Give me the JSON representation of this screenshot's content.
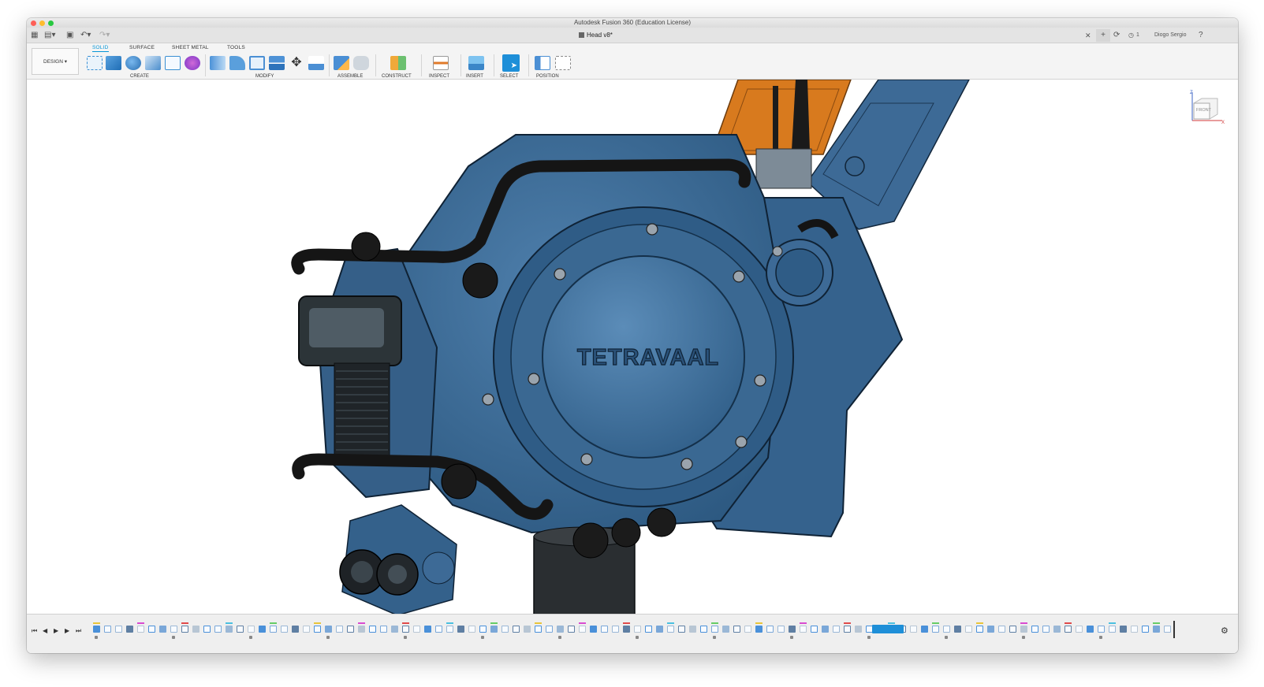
{
  "window": {
    "title": "Autodesk Fusion 360 (Education License)"
  },
  "tabbar": {
    "document_tab": "Head v8*",
    "user_name": "Diogo Sergio",
    "notification_count": "1"
  },
  "ribbon": {
    "workspace": "DESIGN",
    "tabs": [
      {
        "label": "SOLID",
        "active": true
      },
      {
        "label": "SURFACE",
        "active": false
      },
      {
        "label": "SHEET METAL",
        "active": false
      },
      {
        "label": "TOOLS",
        "active": false
      }
    ],
    "groups": {
      "create": "CREATE",
      "modify": "MODIFY",
      "assemble": "ASSEMBLE",
      "construct": "CONSTRUCT",
      "inspect": "INSPECT",
      "insert": "INSERT",
      "select": "SELECT",
      "position": "POSITION"
    }
  },
  "viewport": {
    "model_text": "TETRAVAAL",
    "viewcube_label": "FRONT",
    "model_color": "#3d6a96",
    "accent_color": "#d87a1e"
  },
  "accent_color": "#0696d7"
}
